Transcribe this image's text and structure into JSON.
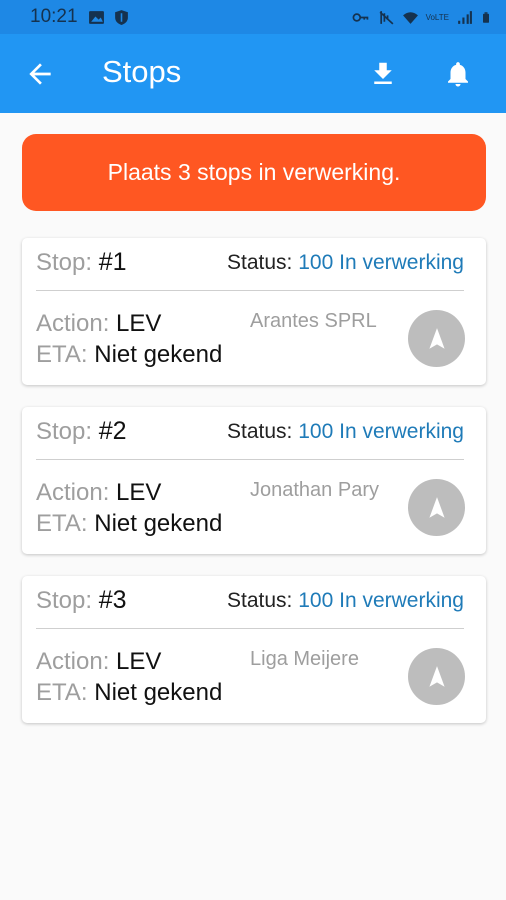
{
  "status_bar": {
    "time": "10:21",
    "icons_left": [
      "image-icon",
      "shield-icon"
    ],
    "icons_right": [
      "key-icon",
      "mute-icon",
      "wifi-icon",
      "signal-icon",
      "battery-icon"
    ],
    "network_label": "VoLTE"
  },
  "app_bar": {
    "title": "Stops",
    "back_icon": "arrow-back-icon",
    "actions": [
      "download-icon",
      "bell-icon"
    ]
  },
  "banner": {
    "text": "Plaats 3 stops in verwerking.",
    "color": "#ff5722"
  },
  "labels": {
    "stop": "Stop:",
    "status": "Status:",
    "action": "Action:",
    "eta": "ETA:"
  },
  "stops": [
    {
      "number": "#1",
      "status": "100 In verwerking",
      "action": "LEV",
      "eta": "Niet gekend",
      "name": "Arantes SPRL"
    },
    {
      "number": "#2",
      "status": "100 In verwerking",
      "action": "LEV",
      "eta": "Niet gekend",
      "name": "Jonathan Pary"
    },
    {
      "number": "#3",
      "status": "100 In verwerking",
      "action": "LEV",
      "eta": "Niet gekend",
      "name": "Liga Meijere"
    }
  ],
  "colors": {
    "app_bar": "#2196f3",
    "status_value": "#1f7bb8",
    "nav_button": "#bdbdbd"
  }
}
